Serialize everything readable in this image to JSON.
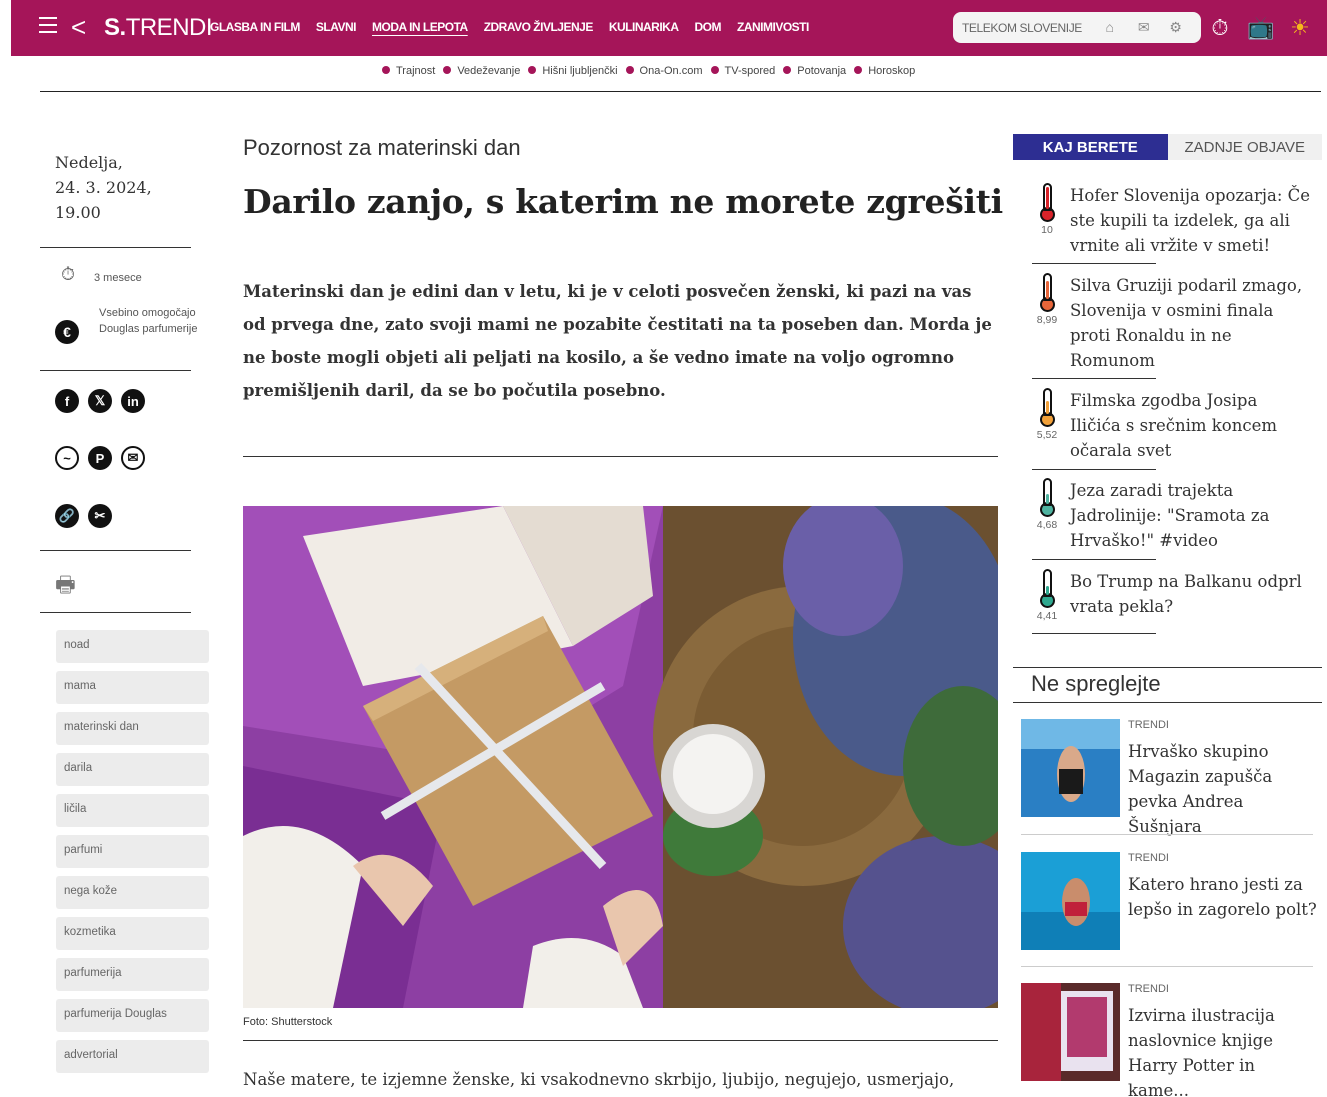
{
  "topbar": {
    "logo_s": "S.",
    "logo_rest": "TRENDI",
    "nav": [
      "GLASBA IN FILM",
      "SLAVNI",
      "MODA IN LEPOTA",
      "ZDRAVO ŽIVLJENJE",
      "KULINARIKA",
      "DOM",
      "ZANIMIVOSTI"
    ],
    "active_nav": "MODA IN LEPOTA",
    "provider": "TELEKOM SLOVENIJE",
    "icons": [
      "menu-icon",
      "back-icon",
      "home-icon",
      "mail-icon",
      "settings-icon",
      "timer-icon",
      "tv-icon",
      "sun-icon"
    ],
    "bar_color": "#a51559"
  },
  "subnav": [
    "Trajnost",
    "Vedeževanje",
    "Hišni ljubljenčki",
    "Ona-On.com",
    "TV-spored",
    "Potovanja",
    "Horoskop"
  ],
  "left": {
    "date_line1": "Nedelja,",
    "date_line2": "24. 3. 2024,",
    "date_line3": "19.00",
    "age": "3 mesece",
    "sponsor": "Vsebino omogočajo Douglas parfumerije",
    "tags": [
      "noad",
      "mama",
      "materinski dan",
      "darila",
      "ličila",
      "parfumi",
      "nega kože",
      "kozmetika",
      "parfumerija",
      "parfumerija Douglas",
      "advertorial"
    ]
  },
  "article": {
    "kicker": "Pozornost za materinski dan",
    "headline": "Darilo zanjo, s katerim ne morete zgrešiti",
    "lead": "Materinski dan je edini dan v letu, ki je v celoti posvečen ženski, ki pazi na vas od prvega dne, zato svoji mami ne pozabite čestitati na ta poseben dan. Morda je ne boste mogli objeti ali peljati na kosilo, a še vedno imate na voljo ogromno premišljenih daril, da se bo počutila posebno.",
    "caption": "Foto: Shutterstock",
    "body": "Naše matere, te izjemne ženske, ki vsakodnevno skrbijo, ljubijo, negujejo, usmerjajo,"
  },
  "sidebar": {
    "tab_active": "KAJ BERETE",
    "tab_other": "ZADNJE OBJAVE",
    "popular": [
      {
        "value": "10",
        "title": "Hofer Slovenija opozarja: Če ste kupili ta izdelek, ga ali vrnite ali vržite v smeti!",
        "color": "#d8232a"
      },
      {
        "value": "8,99",
        "title": "Silva Gruziji podaril zmago, Slovenija v osmini finala proti Ronaldu in ne Romunom",
        "color": "#e8663a"
      },
      {
        "value": "5,52",
        "title": "Filmska zgodba Josipa Iličića s srečnim koncem očarala svet",
        "color": "#f2a13a"
      },
      {
        "value": "4,68",
        "title": "Jeza zaradi trajekta Jadrolinije: \"Sramota za Hrvaško!\" #video",
        "color": "#4fb3a0"
      },
      {
        "value": "4,41",
        "title": "Bo Trump na Balkanu odprl vrata pekla?",
        "color": "#2fa88f"
      }
    ],
    "ne_spreglejte": "Ne spreglejte",
    "cards": [
      {
        "source": "TRENDI",
        "title": "Hrvaško skupino Magazin zapušča pevka Andrea Šušnjara"
      },
      {
        "source": "TRENDI",
        "title": "Katero hrano jesti za lepšo in zagorelo polt?"
      },
      {
        "source": "TRENDI",
        "title": "Izvirna ilustracija naslovnice knjige Harry Potter in kame..."
      }
    ]
  }
}
